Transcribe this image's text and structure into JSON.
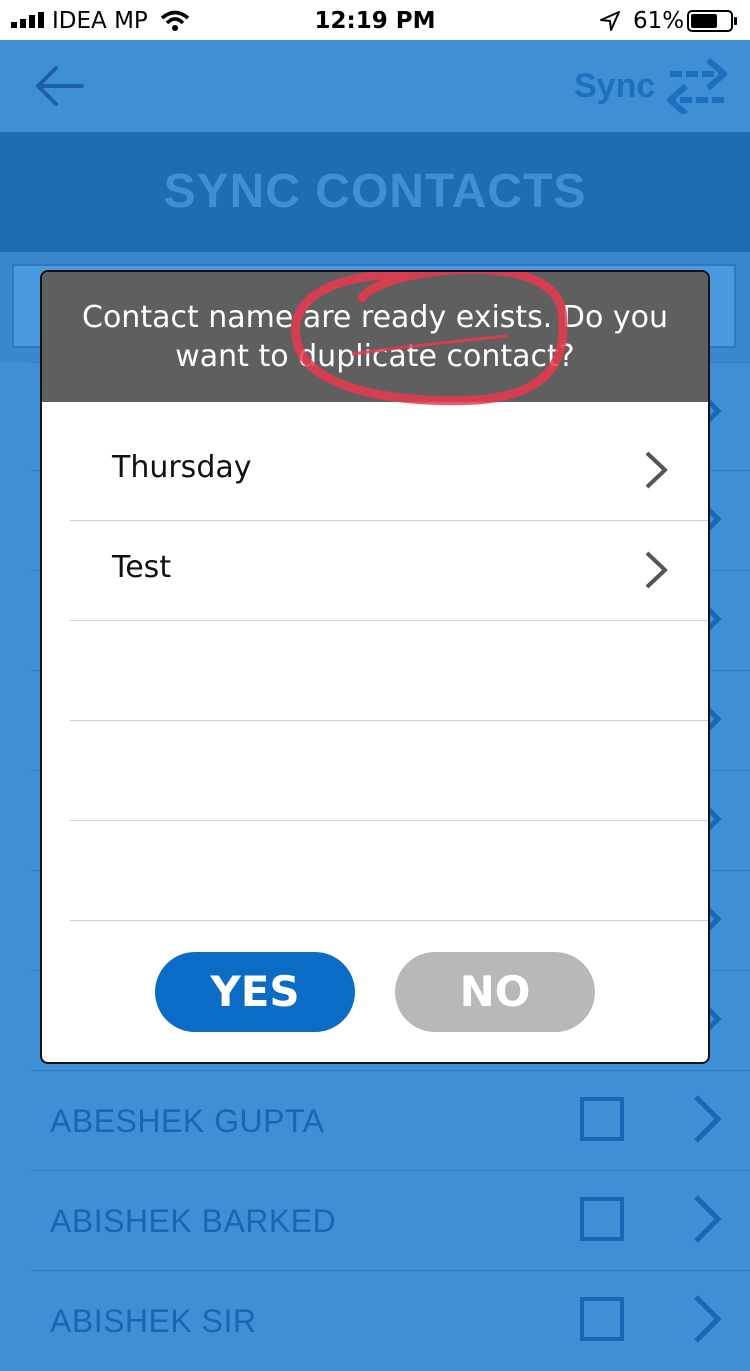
{
  "status_bar": {
    "carrier": "IDEA MP",
    "time": "12:19 PM",
    "battery_percent": "61%"
  },
  "nav": {
    "back_icon": "arrow-left-icon",
    "sync_label": "Sync",
    "sync_icon": "swap-arrows-icon"
  },
  "page": {
    "title": "SYNC CONTACTS"
  },
  "dialog": {
    "message": "Contact name are ready exists. Do you want to duplicate contact?",
    "items": [
      {
        "label": "Thursday"
      },
      {
        "label": "Test"
      }
    ],
    "yes_label": "YES",
    "no_label": "NO",
    "colors": {
      "header": "#5f5f5f",
      "yes": "#0a6cc4",
      "no": "#b8b8b8"
    }
  },
  "contacts": [
    {
      "name": "ABESHEK GUPTA"
    },
    {
      "name": "ABISHEK BARKED"
    },
    {
      "name": "ABISHEK SIR"
    }
  ],
  "colors": {
    "background": "#3f8fd4",
    "title_band": "#1f6cb0",
    "annotation": "#e8384f"
  }
}
